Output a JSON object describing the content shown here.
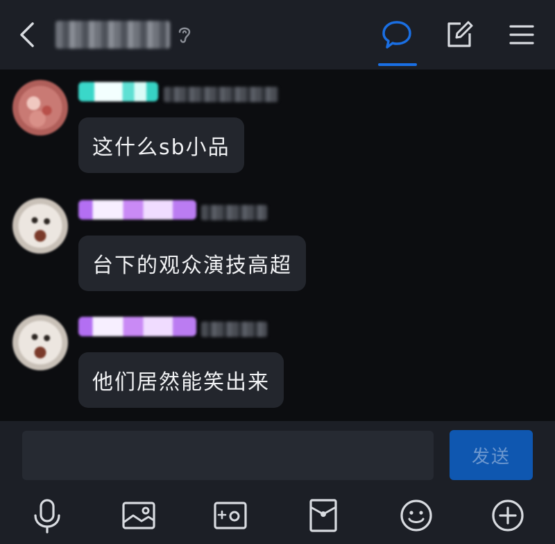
{
  "header": {
    "icons": [
      "back-arrow-icon",
      "hearing-icon",
      "chat-bubble-icon",
      "compose-icon",
      "menu-icon"
    ],
    "accent_color": "#1a6fe3"
  },
  "messages": [
    {
      "avatar": "pink-avatar",
      "badge_color": "#3ad7c9",
      "text": "这什么sb小品"
    },
    {
      "avatar": "cat-avatar",
      "badge_color": "#b36ff2",
      "text": "台下的观众演技高超"
    },
    {
      "avatar": "cat-avatar",
      "badge_color": "#b36ff2",
      "text": "他们居然能笑出来"
    }
  ],
  "composer": {
    "input_value": "",
    "send_label": "发送",
    "send_color": "#0f57b0"
  },
  "toolbar": {
    "icons": [
      "microphone-icon",
      "image-icon",
      "video-icon",
      "red-packet-icon",
      "emoji-icon",
      "plus-icon"
    ]
  }
}
